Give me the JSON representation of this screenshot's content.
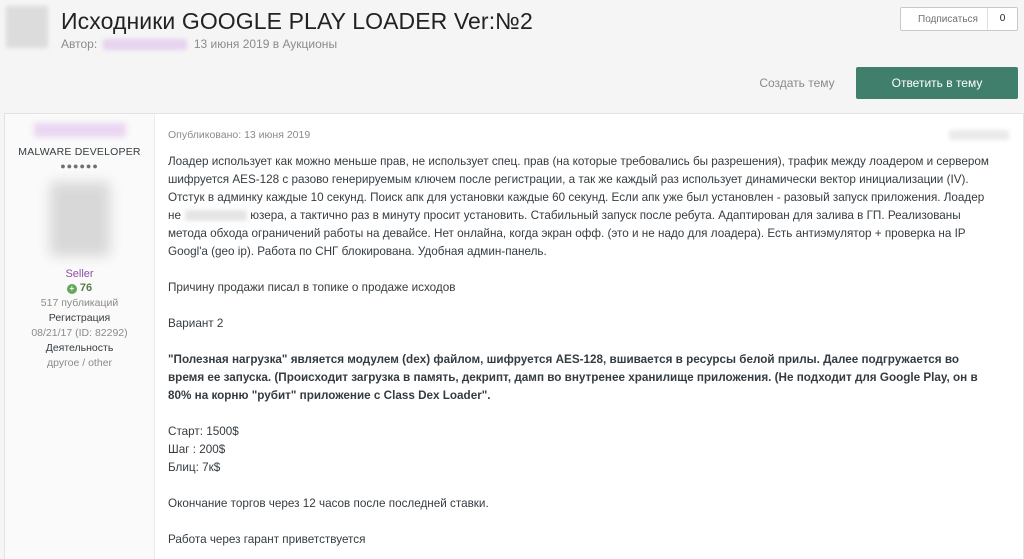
{
  "topic": {
    "title": "Исходники GOOGLE PLAY LOADER Ver:№2",
    "author_label": "Автор:",
    "date_and_forum": "13 июня 2019 в Аукционы"
  },
  "follow": {
    "label": "Подписаться",
    "count": "0"
  },
  "actions": {
    "create_topic": "Создать тему",
    "reply": "Ответить в тему"
  },
  "author": {
    "rank": "MALWARE DEVELOPER",
    "pips": "●●●●●●",
    "group": "Seller",
    "reputation": "76",
    "posts": "517 публикаций",
    "registered_label": "Регистрация",
    "registered_value": "08/21/17 (ID: 82292)",
    "activity_label": "Деятельность",
    "activity_value": "другое / other"
  },
  "post": {
    "published": "Опубликовано: 13 июня 2019",
    "p1_part1": "Лоадер использует как можно меньше прав, не использует спец. прав (на которые требовались бы разрешения), трафик между лоадером и сервером шифруется AES-128 с разово генерируемым ключем после регистрации, а так же каждый раз использует динамически вектор инициализации (IV). Отстук в админку каждые 10 секунд. Поиск апк для установки каждые 60 секунд. Если апк уже был установлен - разовый запуск приложения. Лоадер не",
    "p1_part2": "юзера, а тактично раз в минуту просит установить. Стабильный запуск после ребута. Адаптирован для залива в ГП. Реализованы метода обхода ограничений работы на девайсе. Нет онлайна, когда экран офф. (это и не надо для лоадера).  Есть антиэмулятор + проверка на IP Googl'a (geo ip). Работа по СНГ блокирована. Удобная админ-панель.",
    "p2": "Причину продажи писал в топике о продаже исходов",
    "p3": "Вариант 2",
    "p4": "\"Полезная нагрузка\" является модулем (dex) файлом, шифруется AES-128, вшивается в ресурсы белой прилы. Далее подгружается во время ее запуска. (Происходит загрузка в память, декрипт, дамп во внутренее хранилище приложения. (Не подходит для Google Play, он в 80% на корню \"рубит\" приложение с Class Dex Loader\".",
    "start": "Старт: 1500$",
    "step": "Шаг : 200$",
    "blitz": "Блиц: 7к$",
    "p5": "Окончание торгов через 12 часов после последней ставки.",
    "p6": "Работа через гарант приветствуется"
  }
}
